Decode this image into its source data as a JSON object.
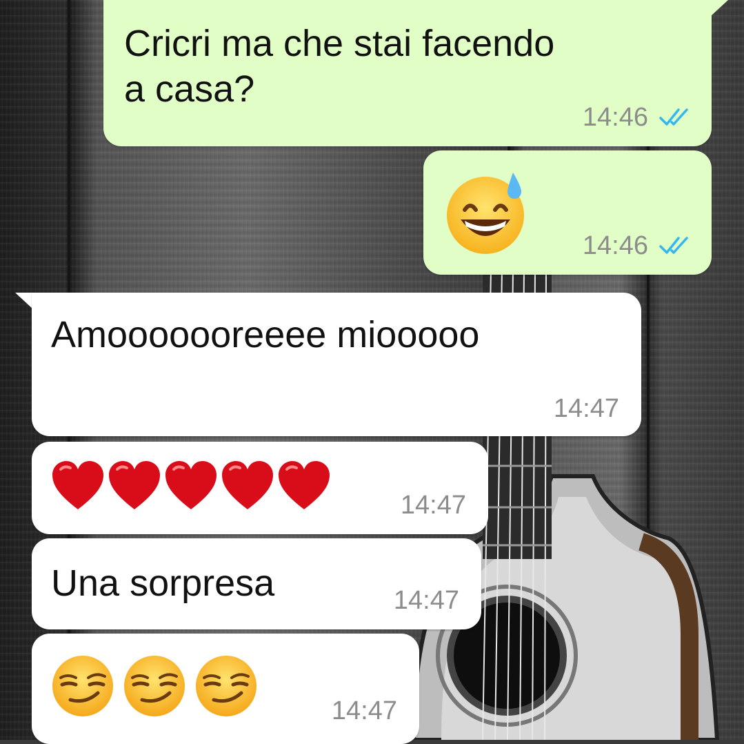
{
  "conversation": {
    "messages": [
      {
        "direction": "outgoing",
        "text": "Cricri ma che stai facendo\na casa?",
        "time": "14:46",
        "status": "read"
      },
      {
        "direction": "outgoing",
        "emoji": "grinning-face-with-sweat",
        "time": "14:46",
        "status": "read"
      },
      {
        "direction": "incoming",
        "text": "Amooooooreeee miooooo",
        "time": "14:47"
      },
      {
        "direction": "incoming",
        "emoji": "red-heart",
        "emoji_count": 5,
        "time": "14:47"
      },
      {
        "direction": "incoming",
        "text": "Una sorpresa",
        "time": "14:47"
      },
      {
        "direction": "incoming",
        "emoji": "smirking-face",
        "emoji_count": 3,
        "time": "14:47"
      }
    ]
  },
  "colors": {
    "outgoing_bubble": "#e1fec6",
    "incoming_bubble": "#ffffff",
    "read_ticks": "#34b7f1",
    "timestamp": "#8c8c8c"
  },
  "icons": {
    "read_receipt": "double-check-icon"
  }
}
